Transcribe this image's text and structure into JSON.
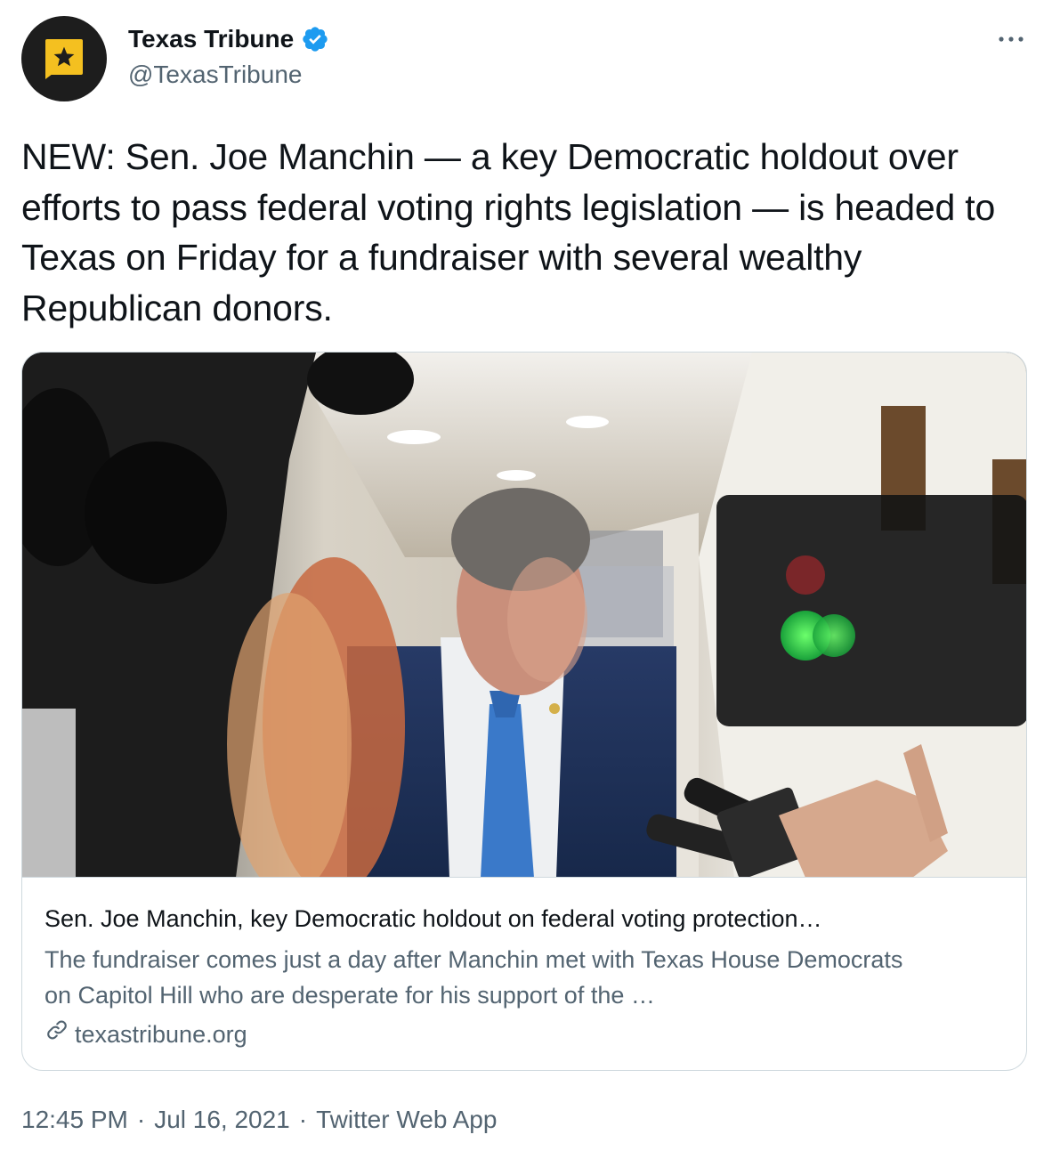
{
  "author": {
    "display_name": "Texas Tribune",
    "handle": "@TexasTribune"
  },
  "tweet": {
    "text": "NEW: Sen. Joe Manchin —  a key Democratic holdout over efforts to pass federal voting rights legislation — is headed to Texas on Friday for a fundraiser with several wealthy Republican donors."
  },
  "card": {
    "title": "Sen. Joe Manchin, key Democratic holdout on federal voting protection…",
    "description": "The fundraiser comes just a day after Manchin met with Texas House Democrats on Capitol Hill who are desperate for his support of the …",
    "domain": "texastribune.org"
  },
  "meta": {
    "time": "12:45 PM",
    "separator": "·",
    "date": "Jul 16, 2021",
    "source": "Twitter Web App"
  },
  "colors": {
    "verified": "#1d9bf0",
    "logo_yellow": "#f4c020",
    "secondary_text": "#536471"
  }
}
